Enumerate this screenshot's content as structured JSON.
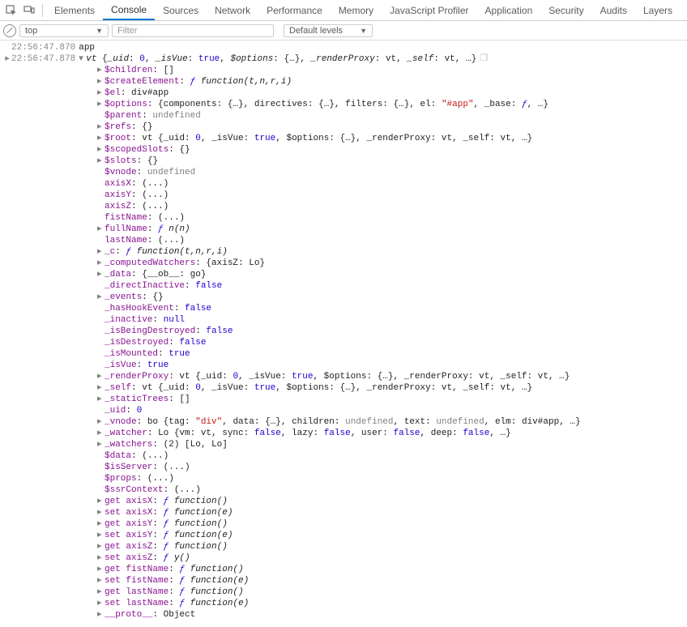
{
  "toolbar": {
    "tabs": [
      "Elements",
      "Console",
      "Sources",
      "Network",
      "Performance",
      "Memory",
      "JavaScript Profiler",
      "Application",
      "Security",
      "Audits",
      "Layers"
    ],
    "active_tab": "Console"
  },
  "subbar": {
    "context": "top",
    "filter_placeholder": "Filter",
    "levels_label": "Default levels"
  },
  "log1": {
    "ts": "22:56:47.870",
    "msg": "app"
  },
  "log2": {
    "ts": "22:56:47.878",
    "head_prefix": "vt ",
    "head_open": "{",
    "uid_k": "_uid",
    "uid_v": "0",
    "isvue_k": "_isVue",
    "isvue_v": "true",
    "opt_k": "$options",
    "opt_v": "{…}",
    "rp_k": "_renderProxy",
    "rp_v": "vt",
    "self_k": "_self",
    "self_v": "vt",
    "ell": "…",
    "head_close": "}"
  },
  "p": {
    "children": "$children",
    "children_v": "[]",
    "createEl": "$createElement",
    "createEl_v": "function(t,n,r,i)",
    "el": "$el",
    "el_v": "div#app",
    "options": "$options",
    "options_pre": "{components: ",
    "options_brace": "{…}",
    "options_dir": ", directives: ",
    "options_flt": ", filters: ",
    "options_el": ", el: ",
    "options_el_v": "\"#app\"",
    "options_base": ", _base: ",
    "options_base_v": "ƒ",
    "options_tail": ", …}",
    "parent": "$parent",
    "undef": "undefined",
    "refs": "$refs",
    "empty_obj": "{}",
    "root": "$root",
    "root_pre": "vt {_uid: ",
    "root_uid": "0",
    "root_isvue": ", _isVue: ",
    "root_true": "true",
    "root_opt": ", $options: ",
    "root_rp": ", _renderProxy: ",
    "root_vt": "vt",
    "root_self": ", _self: ",
    "root_tail": ", …}",
    "scoped": "$scopedSlots",
    "slots": "$slots",
    "vnode": "$vnode",
    "axisX": "axisX",
    "axisY": "axisY",
    "axisZ": "axisZ",
    "paren": "(...)",
    "fistName": "fistName",
    "fullName": "fullName",
    "fullName_v": "n(n)",
    "lastName": "lastName",
    "uc": "_c",
    "uc_v": "function(t,n,r,i)",
    "cw": "_computedWatchers",
    "cw_v": "{axisZ: Lo}",
    "data": "_data",
    "data_v": "{__ob__: go}",
    "dinact": "_directInactive",
    "false": "false",
    "true": "true",
    "null": "null",
    "events": "_events",
    "hhook": "_hasHookEvent",
    "inact": "_inactive",
    "ibd": "_isBeingDestroyed",
    "idest": "_isDestroyed",
    "imount": "_isMounted",
    "isvue": "_isVue",
    "rproxy": "_renderProxy",
    "uself": "_self",
    "strees": "_staticTrees",
    "strees_v": "[]",
    "uid": "_uid",
    "uid_v": "0",
    "uvnode": "_vnode",
    "uvnode_pre": "bo {tag: ",
    "uvnode_tag": "\"div\"",
    "uvnode_data": ", data: ",
    "uvnode_ch": ", children: ",
    "uvnode_txt": ", text: ",
    "uvnode_elm": ", elm: ",
    "uvnode_elm_v": "div#app",
    "uvnode_tail": ", …}",
    "watcher": "_watcher",
    "watcher_pre": "Lo {vm: vt, sync: ",
    "watcher_mid": ", lazy: ",
    "watcher_user": ", user: ",
    "watcher_deep": ", deep: ",
    "watcher_tail": ", …}",
    "watchers": "_watchers",
    "watchers_v": "(2) [Lo, Lo]",
    "sdata": "$data",
    "isserver": "$isServer",
    "sprops": "$props",
    "ssrctx": "$ssrContext",
    "get": "get ",
    "set": "set ",
    "fn0": "function()",
    "fne": "function(e)",
    "fny": "y()",
    "proto": "__proto__",
    "proto_v": "Object"
  }
}
